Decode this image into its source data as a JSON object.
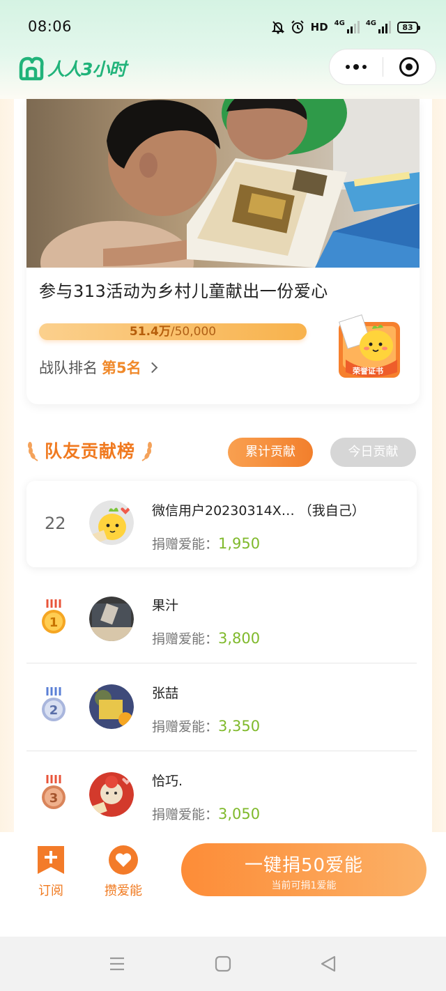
{
  "status_bar": {
    "time": "08:06",
    "hd_label": "HD",
    "network_1": "4G",
    "network_2": "4G",
    "battery": "83"
  },
  "header": {
    "app_name": "人人3小时",
    "logo_icon": "house-heart-logo",
    "more_icon": "more-dots-icon",
    "close_icon": "target-close-icon"
  },
  "project": {
    "title": "参与313活动为乡村儿童献出一份爱心",
    "progress_current": "51.4万",
    "progress_target": "/50,000",
    "progress_fraction": 1.0,
    "rank_label": "战队排名",
    "rank_value": "第5名",
    "certificate_text": "荣誉证书"
  },
  "leaderboard": {
    "title": "队友贡献榜",
    "tab_total": "累计贡献",
    "tab_today": "今日贡献",
    "active_tab": "tab_total",
    "donate_label": "捐赠爱能：",
    "me": {
      "rank": "22",
      "name": "微信用户20230314X…  （我自己）",
      "amount": "1,950"
    },
    "members": [
      {
        "rank": "1",
        "name": "果汁",
        "amount": "3,800",
        "medal_color": "#f5a623"
      },
      {
        "rank": "2",
        "name": "张喆",
        "amount": "3,350",
        "medal_color": "#8fa3d6"
      },
      {
        "rank": "3",
        "name": "恰巧.",
        "amount": "3,050",
        "medal_color": "#d9845a"
      }
    ]
  },
  "actions": {
    "subscribe_label": "订阅",
    "save_label": "攒爱能",
    "donate_main": "一键捐50爱能",
    "donate_sub": "当前可捐1爱能"
  },
  "colors": {
    "accent": "#f07a20",
    "brand": "#21b37a",
    "amount": "#7fb92b"
  }
}
